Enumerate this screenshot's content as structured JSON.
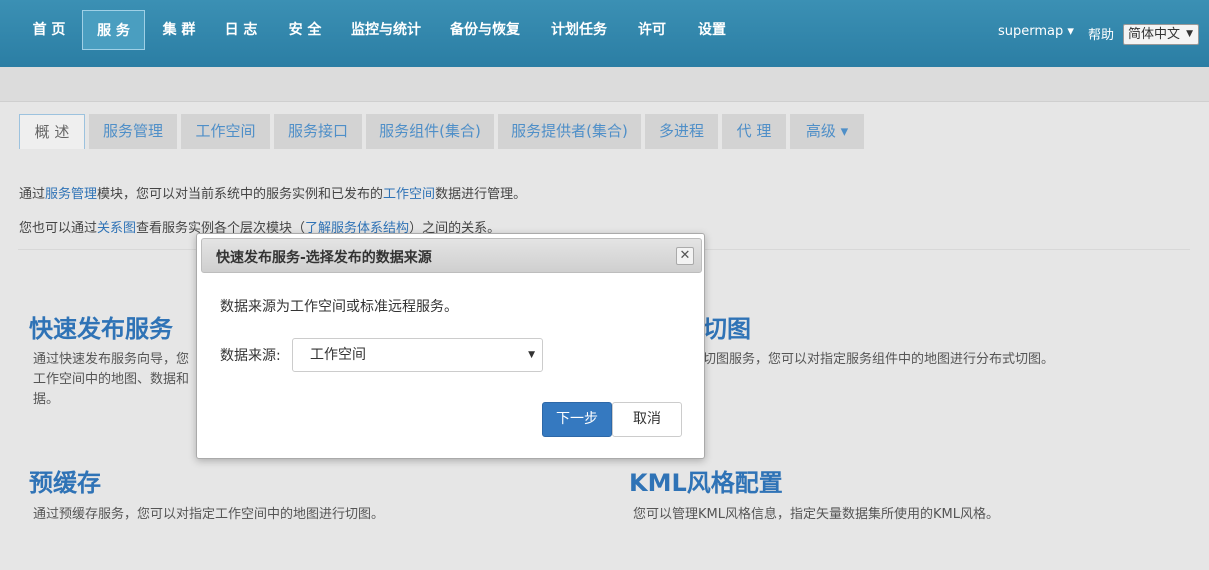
{
  "nav": {
    "items": [
      "首 页",
      "服 务",
      "集 群",
      "日 志",
      "安 全",
      "监控与统计",
      "备份与恢复",
      "计划任务",
      "许可",
      "设置"
    ],
    "user": "supermap ▾",
    "help": "帮助",
    "language": "简体中文"
  },
  "tabs": [
    "概 述",
    "服务管理",
    "工作空间",
    "服务接口",
    "服务组件(集合)",
    "服务提供者(集合)",
    "多进程",
    "代 理",
    "高级 ▾"
  ],
  "intro": {
    "line1_pre": "通过",
    "line1_link1": "服务管理",
    "line1_mid": "模块，您可以对当前系统中的服务实例和已发布的",
    "line1_link2": "工作空间",
    "line1_post": "数据进行管理。",
    "line2_pre": "您也可以通过",
    "line2_link1": "关系图",
    "line2_mid": "查看服务实例各个层次模块（",
    "line2_link2": "了解服务体系结构",
    "line2_post": "）之间的关系。"
  },
  "features": {
    "quick_publish": {
      "title": "快速发布服务",
      "desc_line1": "通过快速发布服务向导，您",
      "desc_line2": "工作空间中的地图、数据和",
      "desc_line3": "据。"
    },
    "tiling": {
      "title": "切图",
      "desc": "切图服务，您可以对指定服务组件中的地图进行分布式切图。"
    },
    "precache": {
      "title": "预缓存",
      "desc": "通过预缓存服务，您可以对指定工作空间中的地图进行切图。"
    },
    "kml": {
      "title": "KML风格配置",
      "desc": "您可以管理KML风格信息，指定矢量数据集所使用的KML风格。"
    }
  },
  "dialog": {
    "title": "快速发布服务-选择发布的数据来源",
    "close_glyph": "✕",
    "message": "数据来源为工作空间或标准远程服务。",
    "source_label": "数据来源:",
    "source_value": "工作空间",
    "next_button": "下一步",
    "cancel_button": "取消"
  },
  "colors": {
    "nav_bg": "#2b7ea4",
    "link": "#2f73b6",
    "primary_button": "#3579c0"
  }
}
